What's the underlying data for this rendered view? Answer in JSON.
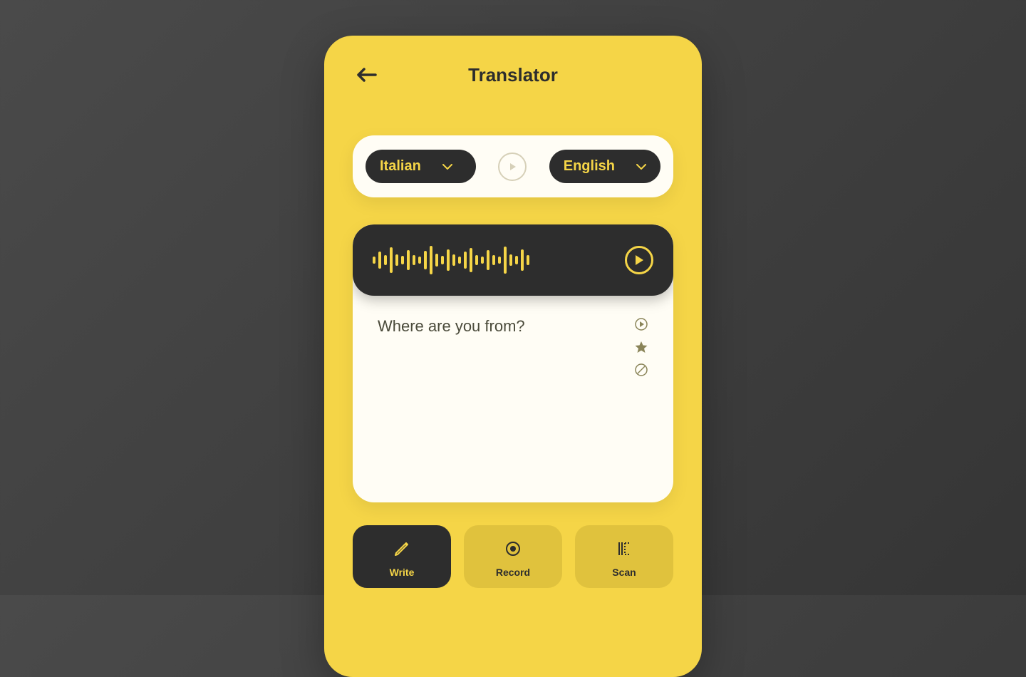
{
  "header": {
    "title": "Translator"
  },
  "languages": {
    "source": "Italian",
    "target": "English"
  },
  "translation": {
    "result_text": "Where are you from?"
  },
  "nav": {
    "write": "Write",
    "record": "Record",
    "scan": "Scan"
  },
  "colors": {
    "accent": "#F5D547",
    "dark": "#2d2d2d",
    "card": "#FFFDF5",
    "nav_inactive": "#E0C23D"
  }
}
